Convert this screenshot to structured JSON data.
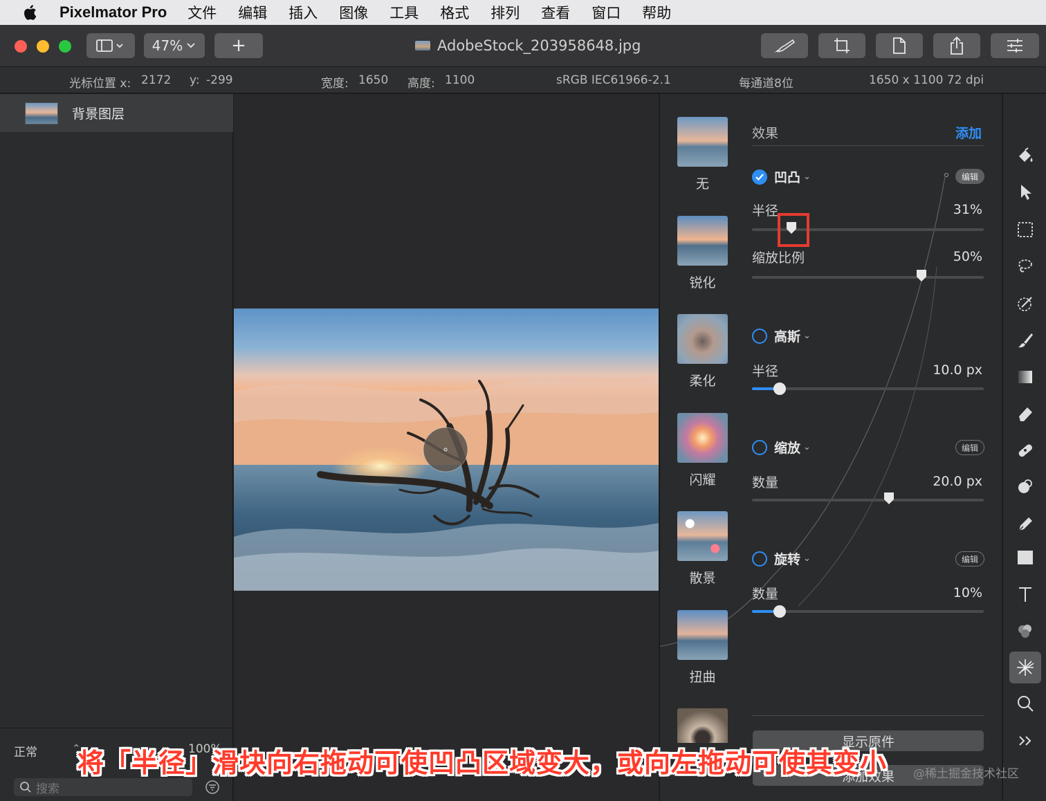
{
  "menubar": {
    "app_name": "Pixelmator Pro",
    "items": [
      "文件",
      "编辑",
      "插入",
      "图像",
      "工具",
      "格式",
      "排列",
      "查看",
      "窗口",
      "帮助"
    ]
  },
  "toolbar": {
    "zoom": "47%",
    "add_label": "+",
    "document_title": "AdobeStock_203958648.jpg"
  },
  "infobar": {
    "cursor_label": "光标位置 x:",
    "cursor_x": "2172",
    "cursor_y_label": "y:",
    "cursor_y": "-299",
    "width_label": "宽度:",
    "width": "1650",
    "height_label": "高度:",
    "height": "1100",
    "color_profile": "sRGB IEC61966-2.1",
    "bit_depth": "每通道8位",
    "dimensions": "1650 x 1100 72 dpi"
  },
  "layers": {
    "items": [
      {
        "name": "背景图层"
      }
    ],
    "blend_mode": "正常",
    "opacity": "100%",
    "search_placeholder": "搜索"
  },
  "effects": {
    "header": "效果",
    "add_label": "添加",
    "presets": [
      "无",
      "锐化",
      "柔化",
      "闪耀",
      "散景",
      "扭曲"
    ],
    "list": [
      {
        "name": "凹凸",
        "enabled": true,
        "edit": "编辑",
        "params": [
          {
            "label": "半径",
            "value": "31%",
            "fraction": 0.17
          },
          {
            "label": "缩放比例",
            "value": "50%",
            "fraction": 0.73
          }
        ]
      },
      {
        "name": "高斯",
        "enabled": false,
        "params": [
          {
            "label": "半径",
            "value": "10.0 px",
            "fraction": 0.12
          }
        ]
      },
      {
        "name": "缩放",
        "enabled": false,
        "edit": "编辑",
        "params": [
          {
            "label": "数量",
            "value": "20.0 px",
            "fraction": 0.59
          }
        ]
      },
      {
        "name": "旋转",
        "enabled": false,
        "edit": "编辑",
        "params": [
          {
            "label": "数量",
            "value": "10%",
            "fraction": 0.12
          }
        ]
      }
    ],
    "show_original": "显示原件",
    "add_effect": "添加效果"
  },
  "caption": "将「半径」滑块向右拖动可使凹凸区域变大，或向左拖动可使其变小",
  "watermark": "@稀土掘金技术社区",
  "colors": {
    "accent": "#2f8ef4",
    "highlight": "#e53b2f"
  }
}
